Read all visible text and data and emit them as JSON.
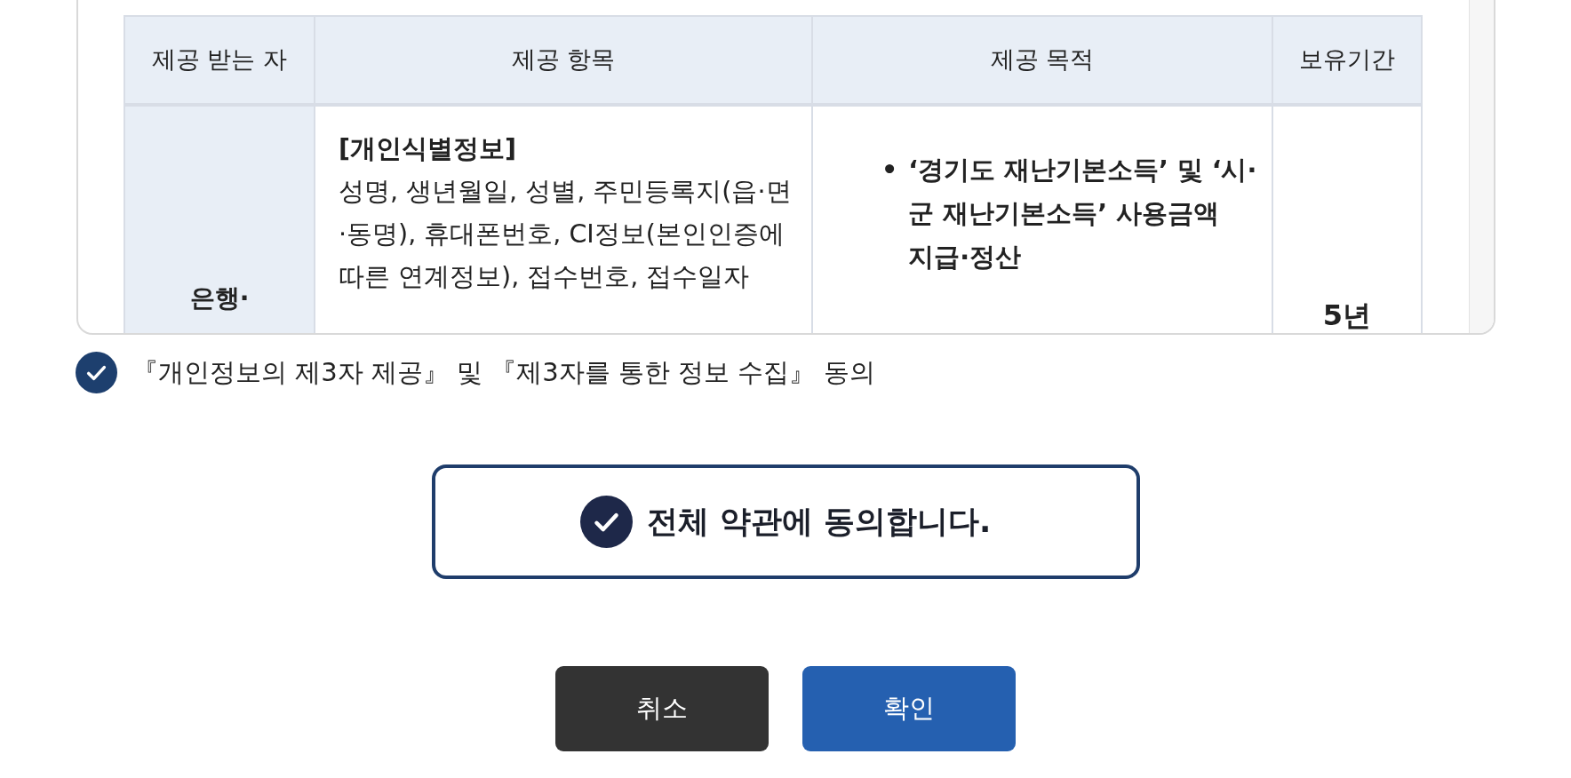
{
  "terms_table": {
    "columns": [
      "제공 받는 자",
      "제공 항목",
      "제공 목적",
      "보유기간"
    ],
    "rows": [
      {
        "recipient": "은행·",
        "items_heading": "[개인식별정보]",
        "items": "성명, 생년월일, 성별, 주민등록지(읍·면·동명), 휴대폰번호, CI정보(본인인증에 따른 연계정보), 접수번호, 접수일자",
        "purposes": [
          {
            "bullet": "•",
            "text": "‘경기도 재난기본소득’ 및 ‘시·군 재난기본소득’ 사용금액 지급·정산"
          }
        ],
        "retention": "5년"
      }
    ]
  },
  "consent_checkbox": {
    "label": "『개인정보의 제3자 제공』 및 『제3자를 통한 정보 수집』 동의",
    "checked": true
  },
  "agree_all": {
    "label": "전체 약관에 동의합니다.",
    "checked": true
  },
  "buttons": [
    {
      "label": "취소",
      "kind": "cancel"
    },
    {
      "label": "확인",
      "kind": "confirm"
    }
  ]
}
